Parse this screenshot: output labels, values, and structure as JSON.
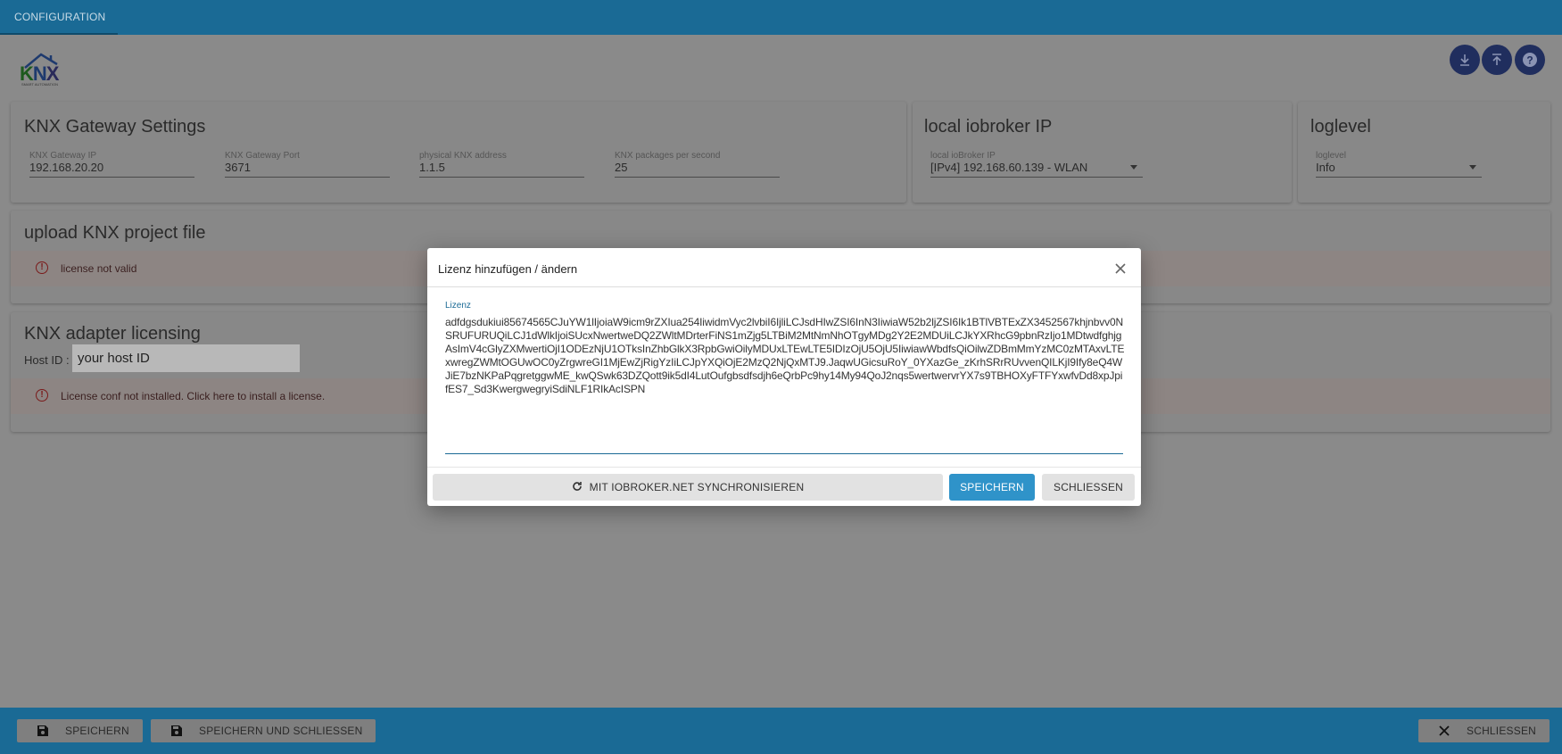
{
  "topbar": {
    "tab_label": "CONFIGURATION"
  },
  "logo": {
    "text_k": "K",
    "text_n": "N",
    "text_x": "X",
    "subtitle": "SMART AUTOMATION"
  },
  "header_actions": {
    "download_icon": "download-icon",
    "upload_icon": "upload-icon",
    "help_icon": "help-icon"
  },
  "gateway": {
    "title": "KNX Gateway Settings",
    "fields": [
      {
        "label": "KNX Gateway IP",
        "value": "192.168.20.20"
      },
      {
        "label": "KNX Gateway Port",
        "value": "3671"
      },
      {
        "label": "physical KNX address",
        "value": "1.1.5"
      },
      {
        "label": "KNX packages per second",
        "value": "25"
      }
    ]
  },
  "local_ip": {
    "title": "local iobroker IP",
    "field_label": "local ioBroker IP",
    "value": "[IPv4] 192.168.60.139 - WLAN"
  },
  "loglevel": {
    "title": "loglevel",
    "field_label": "loglevel",
    "value": "Info"
  },
  "upload": {
    "title": "upload KNX project file",
    "alert": "license not valid"
  },
  "licensing": {
    "title": "KNX adapter licensing",
    "host_label": "Host ID :",
    "host_value": "your host ID",
    "alert": "License conf not installed. Click here to install a license."
  },
  "footer": {
    "save": "SPEICHERN",
    "save_close": "SPEICHERN UND SCHLIESSEN",
    "close": "SCHLIESSEN"
  },
  "modal": {
    "title": "Lizenz hinzufügen / ändern",
    "field_label": "Lizenz",
    "license_text": "adfdgsdukiui85674565CJuYW1lIjoiaW9icm9rZXIua254IiwidmVyc2lvbiI6IjliLCJsdHIwZSI6InN3IiwiaW52b2ljZSI6Ik1BTlVBTExZX3452567khjnbvv0NSRUFURUQiLCJ1dWlkIjoiSUcxNwertweDQ2ZWltMDrterFiNS1mZjg5LTBiM2MtNmNhOTgyMDg2Y2E2MDUiLCJkYXRhcG9pbnRzIjo1MDtwdfghjgAsImV4cGlyZXMwertiOjI1ODEzNjU1OTksInZhbGlkX3RpbGwiOilyMDUxLTEwLTE5IDIzOjU5OjU5IiwiawWbdfsQiOilwZDBmMmYzMC0zMTAxvLTExwregZWMtOGUwOC0yZrgwreGI1MjEwZjRigYzIiLCJpYXQiOjE2MzQ2NjQxMTJ9.JaqwUGicsuRoY_0YXazGe_zKrhSRrRUvvenQILKjI9Ify8eQ4WJiE7bzNKPaPqgretggwME_kwQSwk63DZQott9ik5dI4LutOufgbsdfsdjh6eQrbPc9hy14My94QoJ2nqs5wertwervrYX7s9TBHOXyFTFYxwfvDd8xpJpifES7_Sd3KwergwegryiSdiNLF1RIkAcISPN",
    "sync_button": "MIT IOBROKER.NET SYNCHRONISIEREN",
    "save_button": "SPEICHERN",
    "close_button": "SCHLIESSEN"
  }
}
